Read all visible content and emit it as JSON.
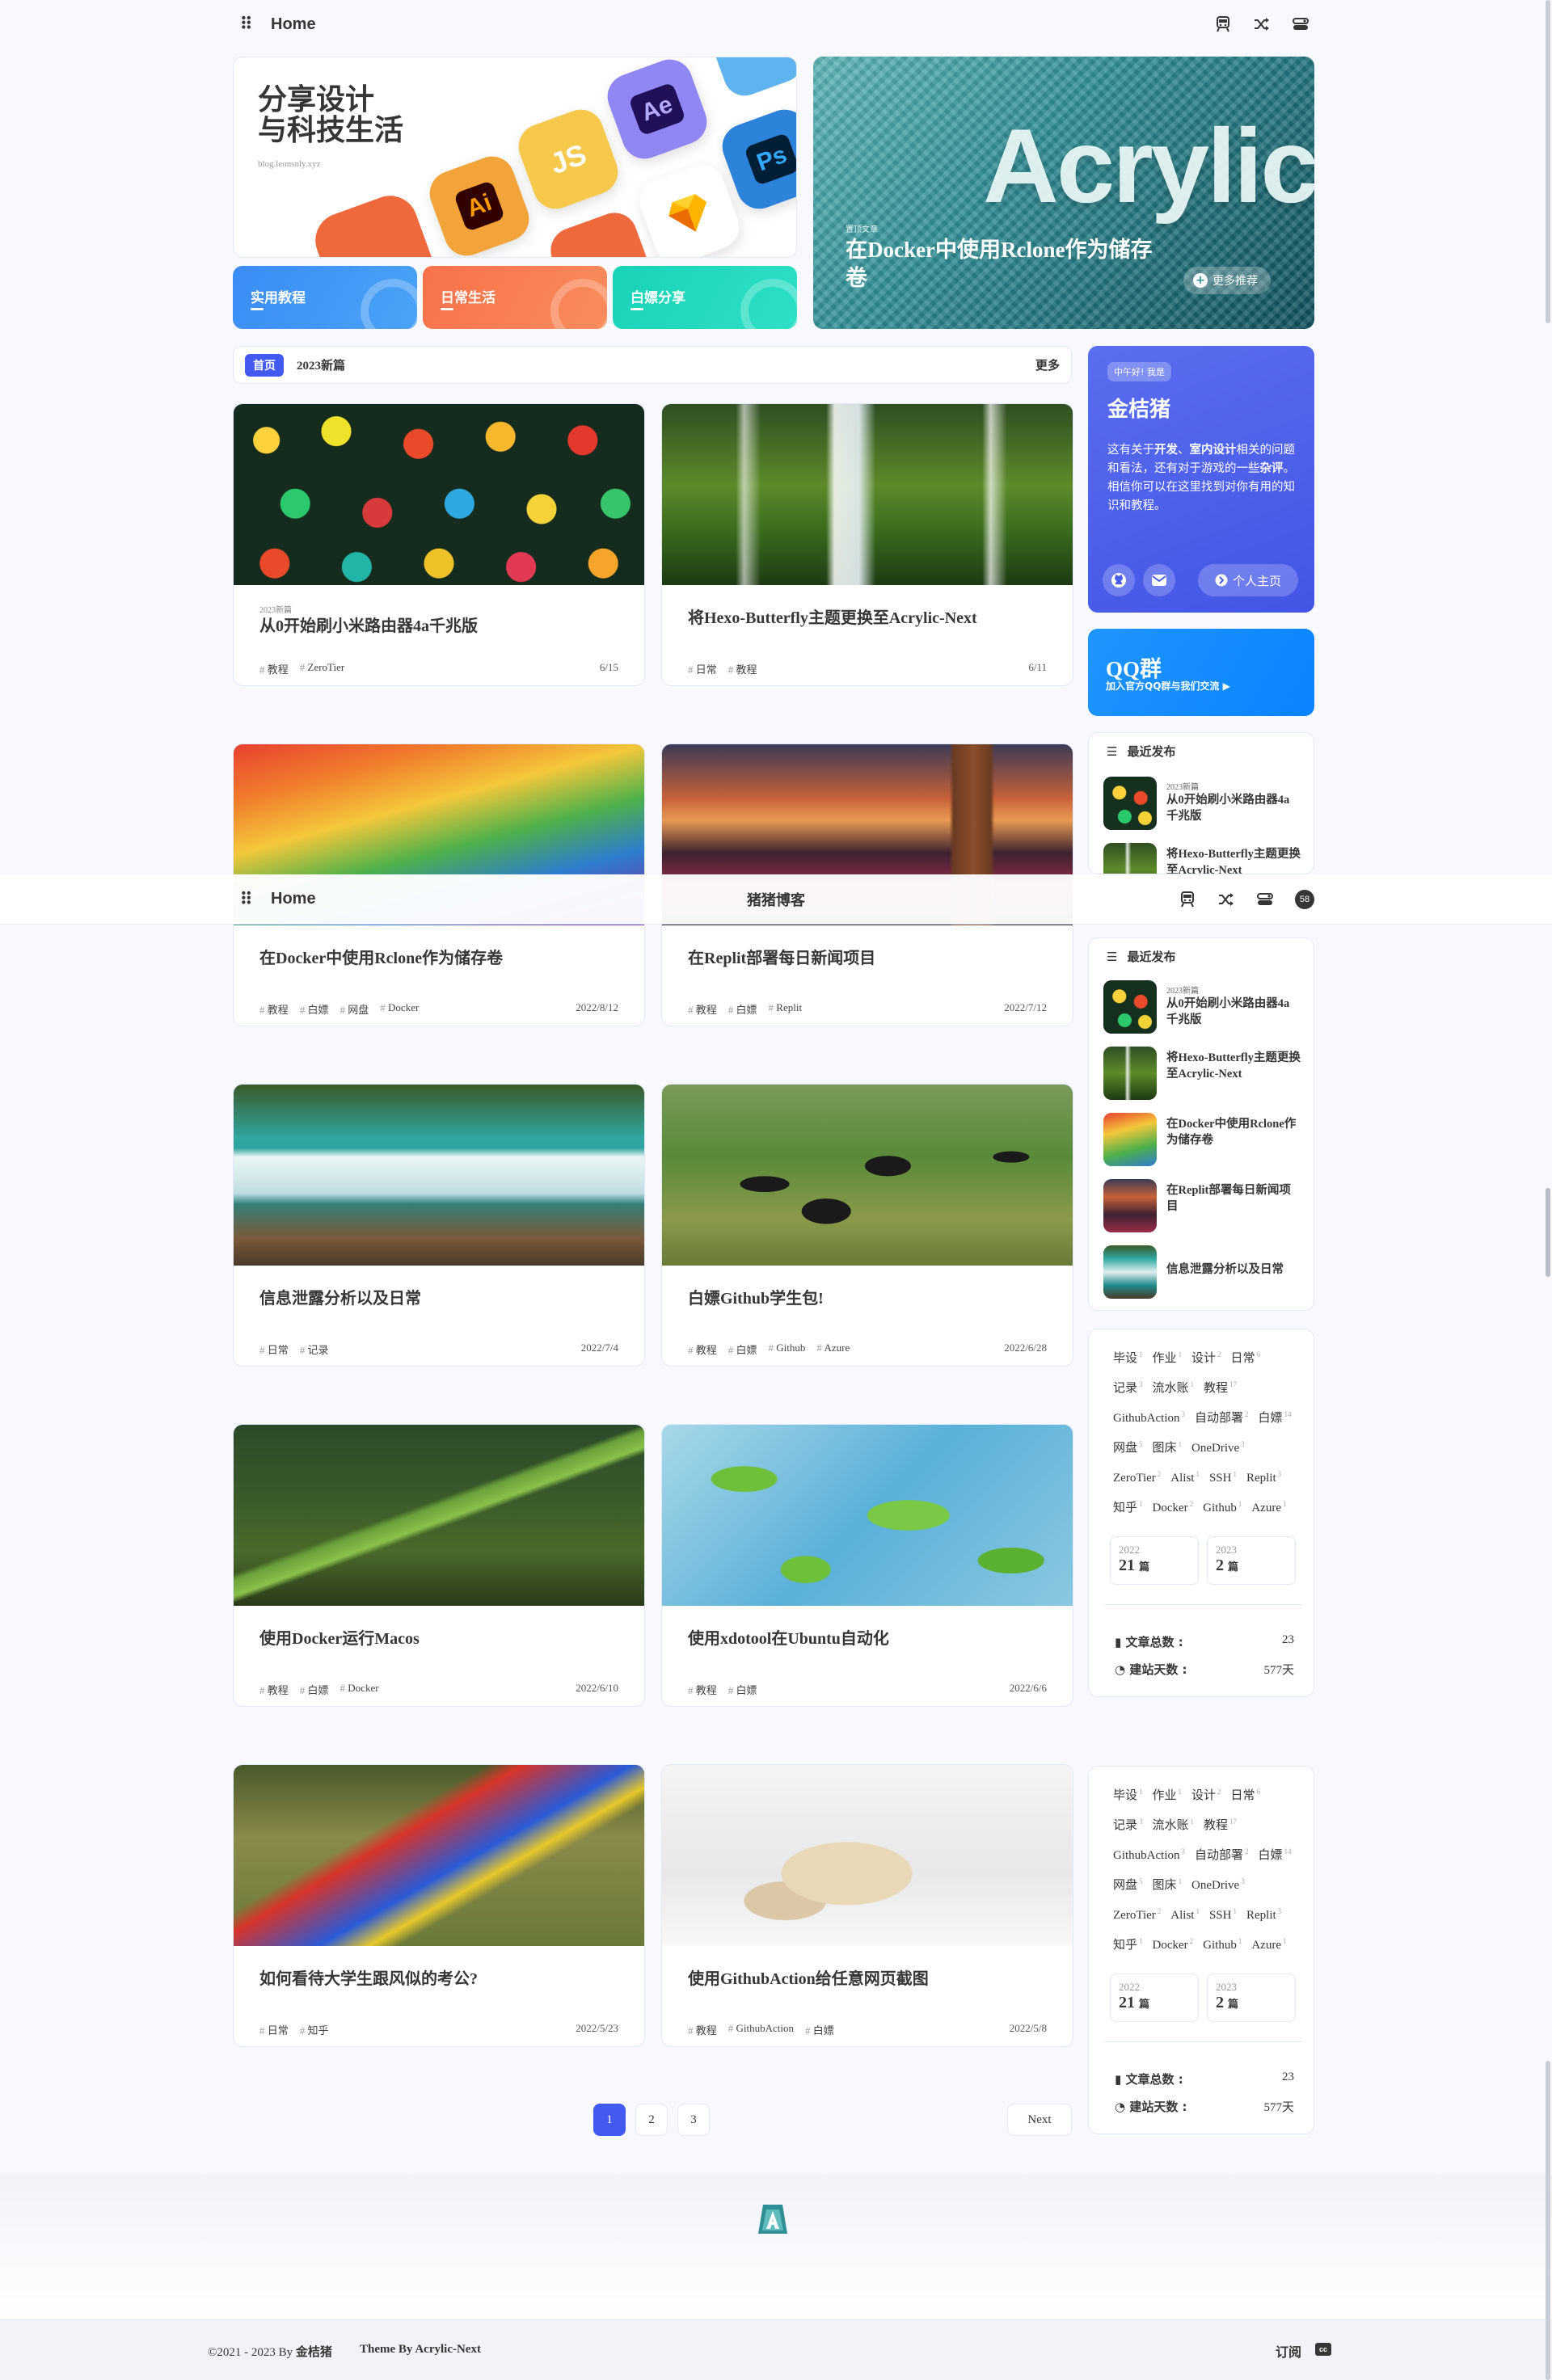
{
  "nav": {
    "home_label": "Home",
    "site_title": "猪猪博客",
    "counter": "58",
    "icons": [
      "train-icon",
      "shuffle-icon",
      "switch-icon"
    ]
  },
  "hero": {
    "title_line1": "分享设计",
    "title_line2": "与科技生活",
    "url": "blog.leonsnly.xyz",
    "app_tiles": [
      "Ai",
      "JS",
      "Ae",
      "Ps"
    ],
    "categories": [
      {
        "label": "实用教程",
        "color": "#3a8cf4"
      },
      {
        "label": "日常生活",
        "color": "#f7714a"
      },
      {
        "label": "白嫖分享",
        "color": "#19d3b7"
      }
    ]
  },
  "featured": {
    "tag": "置顶文章",
    "word": "Acrylic",
    "title": "在Docker中使用Rclone作为储存卷",
    "more_label": "更多推荐"
  },
  "category_bar": {
    "active": "首页",
    "tab": "2023新篇",
    "more": "更多"
  },
  "posts": [
    {
      "category": "2023新篇",
      "title": "从0开始刷小米路由器4a千兆版",
      "tags": [
        "教程",
        "ZeroTier"
      ],
      "date": "6/15"
    },
    {
      "category": "",
      "title": "将Hexo-Butterfly主题更换至Acrylic-Next",
      "tags": [
        "日常",
        "教程"
      ],
      "date": "6/11"
    },
    {
      "category": "",
      "title": "在Docker中使用Rclone作为储存卷",
      "tags": [
        "教程",
        "白嫖",
        "网盘",
        "Docker"
      ],
      "date": "2022/8/12"
    },
    {
      "category": "",
      "title": "在Replit部署每日新闻项目",
      "tags": [
        "教程",
        "白嫖",
        "Replit"
      ],
      "date": "2022/7/12"
    },
    {
      "category": "",
      "title": "信息泄露分析以及日常",
      "tags": [
        "日常",
        "记录"
      ],
      "date": "2022/7/4"
    },
    {
      "category": "",
      "title": "白嫖Github学生包!",
      "tags": [
        "教程",
        "白嫖",
        "Github",
        "Azure"
      ],
      "date": "2022/6/28"
    },
    {
      "category": "",
      "title": "使用Docker运行Macos",
      "tags": [
        "教程",
        "白嫖",
        "Docker"
      ],
      "date": "2022/6/10"
    },
    {
      "category": "",
      "title": "使用xdotool在Ubuntu自动化",
      "tags": [
        "教程",
        "白嫖"
      ],
      "date": "2022/6/6"
    },
    {
      "category": "",
      "title": "如何看待大学生跟风似的考公?",
      "tags": [
        "日常",
        "知乎"
      ],
      "date": "2022/5/23"
    },
    {
      "category": "",
      "title": "使用GithubAction给任意网页截图",
      "tags": [
        "教程",
        "GithubAction",
        "白嫖"
      ],
      "date": "2022/5/8"
    }
  ],
  "author": {
    "greeting": "中午好! 我是",
    "name": "金桔猪",
    "desc_1": "这有关于",
    "desc_b1": "开发",
    "desc_2": "、",
    "desc_b2": "室内设计",
    "desc_3": "相关的问题和看法，还有对于游戏的一些",
    "desc_b3": "杂评",
    "desc_4": "。相信你可以在这里找到对你有用的知识和教程。",
    "home_label": "个人主页"
  },
  "qq": {
    "title": "QQ群",
    "subtitle": "加入官方QQ群与我们交流 ▶"
  },
  "recent": {
    "heading": "最近发布",
    "items": [
      {
        "category": "2023新篇",
        "title": "从0开始刷小米路由器4a千兆版"
      },
      {
        "category": "",
        "title": "将Hexo-Butterfly主题更换至Acrylic-Next"
      },
      {
        "category": "",
        "title": "在Docker中使用Rclone作为储存卷"
      },
      {
        "category": "",
        "title": "在Replit部署每日新闻项目"
      },
      {
        "category": "",
        "title": "信息泄露分析以及日常"
      }
    ]
  },
  "tags": [
    {
      "name": "毕设",
      "count": "1"
    },
    {
      "name": "作业",
      "count": "1"
    },
    {
      "name": "设计",
      "count": "2"
    },
    {
      "name": "日常",
      "count": "6"
    },
    {
      "name": "记录",
      "count": "3"
    },
    {
      "name": "流水账",
      "count": "1"
    },
    {
      "name": "教程",
      "count": "17"
    },
    {
      "name": "GithubAction",
      "count": "3"
    },
    {
      "name": "自动部署",
      "count": "2"
    },
    {
      "name": "白嫖",
      "count": "14"
    },
    {
      "name": "网盘",
      "count": "5"
    },
    {
      "name": "图床",
      "count": "1"
    },
    {
      "name": "OneDrive",
      "count": "3"
    },
    {
      "name": "ZeroTier",
      "count": "2"
    },
    {
      "name": "Alist",
      "count": "1"
    },
    {
      "name": "SSH",
      "count": "1"
    },
    {
      "name": "Replit",
      "count": "3"
    },
    {
      "name": "知乎",
      "count": "1"
    },
    {
      "name": "Docker",
      "count": "2"
    },
    {
      "name": "Github",
      "count": "1"
    },
    {
      "name": "Azure",
      "count": "1"
    }
  ],
  "archive": [
    {
      "year": "2022",
      "count": "21",
      "unit": "篇"
    },
    {
      "year": "2023",
      "count": "2",
      "unit": "篇"
    }
  ],
  "stats": {
    "posts_label": "文章总数 :",
    "posts_value": "23",
    "days_label": "建站天数 :",
    "days_value": "577天"
  },
  "pagination": {
    "pages": [
      "1",
      "2",
      "3"
    ],
    "next": "Next"
  },
  "footer": {
    "copyright": "©2021 - 2023 By",
    "author": "金桔猪",
    "theme": "Theme By Acrylic-Next",
    "subscribe": "订阅",
    "cc": "cc"
  },
  "colors": {
    "accent": "#425aef",
    "background": "#f7f9fe",
    "text": "#363636"
  }
}
